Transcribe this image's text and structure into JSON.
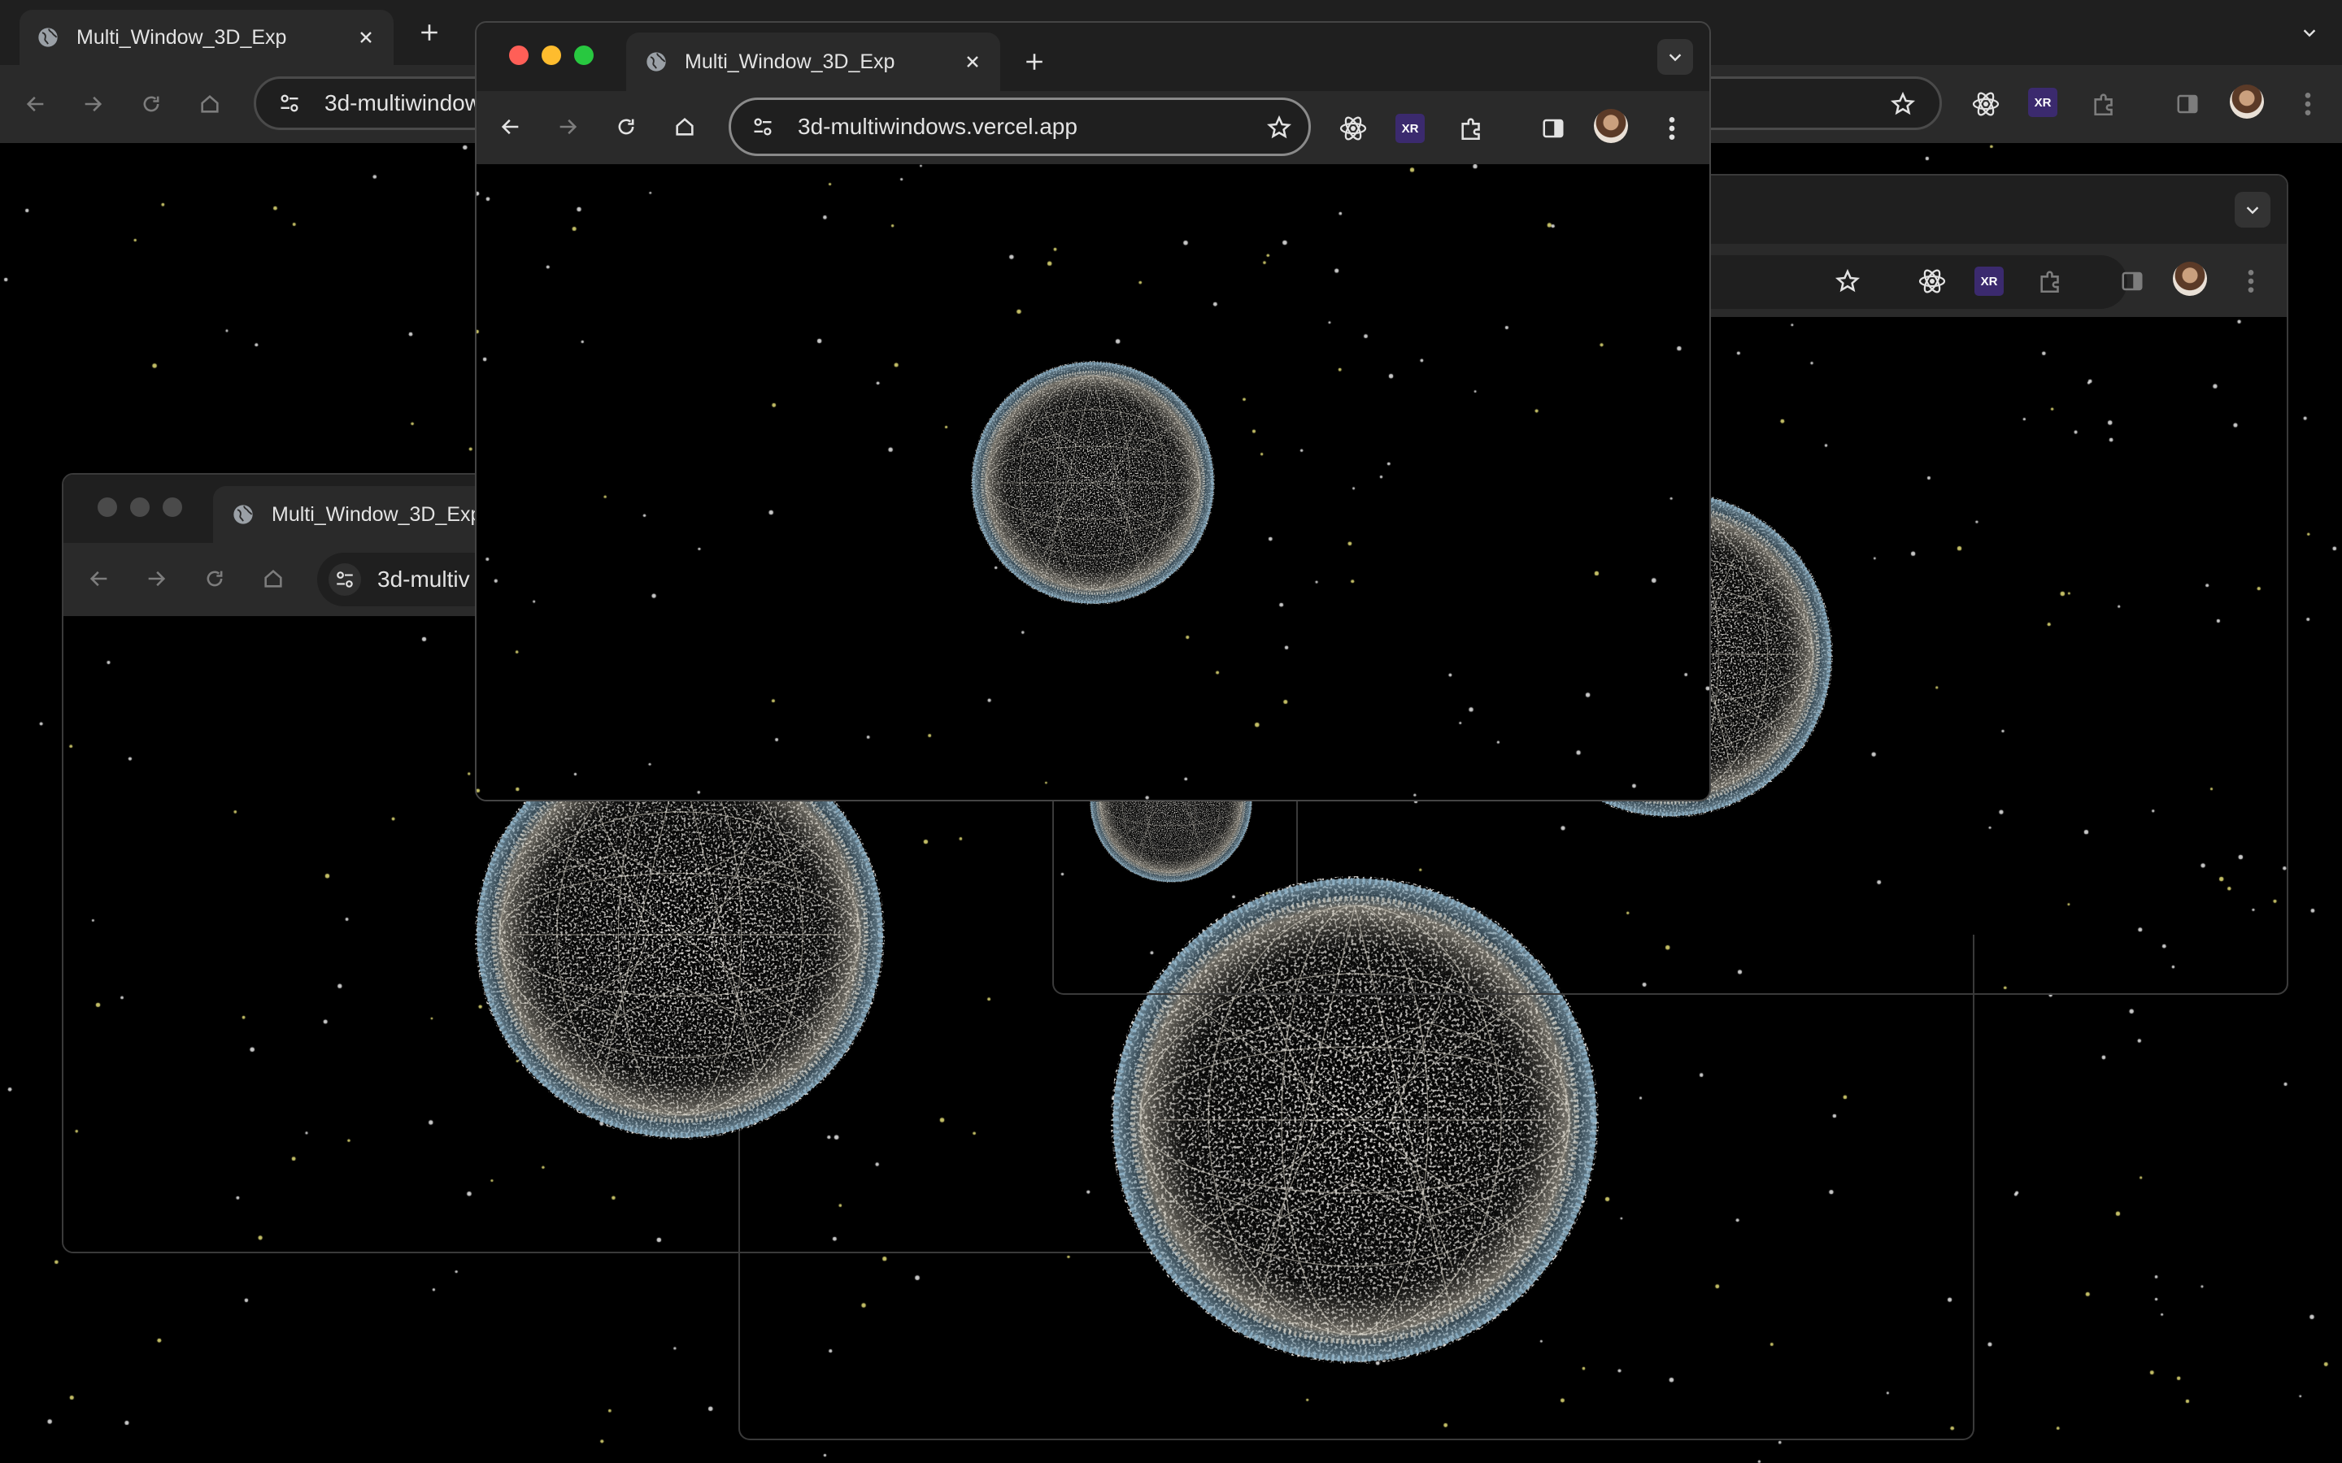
{
  "tab_title": "Multi_Window_3D_Exp",
  "url": "3d-multiwindows.vercel.app",
  "url_truncated_back": "3d-multiwindow",
  "url_truncated_left": "3d-multiv",
  "extensions": {
    "xr_badge_label": "XR"
  },
  "icons": {
    "tab_favicon": "globe-icon",
    "new_tab": "plus-icon",
    "close_tab": "close-icon",
    "tab_search": "chevron-down-icon",
    "back": "arrow-left-icon",
    "forward": "arrow-right-icon",
    "reload": "reload-icon",
    "home": "home-icon",
    "site_info": "tune-icon",
    "bookmark": "star-icon",
    "react_devtools": "atom-icon",
    "extensions": "puzzle-icon",
    "side_panel": "side-panel-icon",
    "menu": "kebab-icon"
  },
  "colors": {
    "tabstrip": "#1f1f1f",
    "toolbar": "#2a2a2a",
    "omnibox": "#1f1f1f",
    "traffic_red": "#ff5f57",
    "traffic_yellow": "#febc2e",
    "traffic_green": "#28c840",
    "traffic_inactive": "#4a4a4a",
    "sphere_white": "#d8d3c6",
    "sphere_blue": "#8fb3c8"
  },
  "windows": [
    {
      "name": "fullscreen-window",
      "focused": false
    },
    {
      "name": "right-window",
      "focused": false
    },
    {
      "name": "left-window",
      "focused": false
    },
    {
      "name": "bottom-window",
      "focused": false
    },
    {
      "name": "front-window",
      "focused": true
    }
  ]
}
